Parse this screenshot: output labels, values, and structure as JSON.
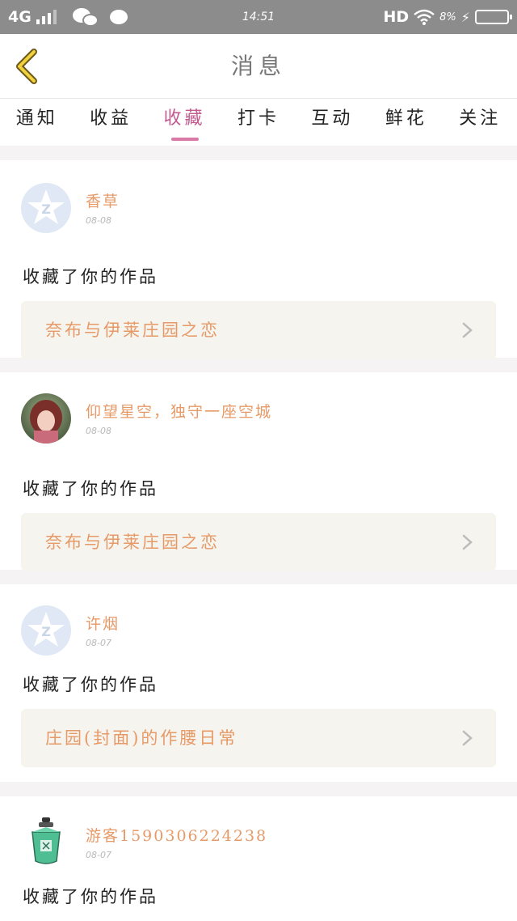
{
  "status_bar": {
    "network": "4G",
    "time": "14:51",
    "hd": "HD",
    "battery": "8%"
  },
  "header": {
    "title": "消息",
    "back_icon": "back-chevron-icon"
  },
  "tabs": [
    {
      "label": "通知",
      "active": false
    },
    {
      "label": "收益",
      "active": false
    },
    {
      "label": "收藏",
      "active": true
    },
    {
      "label": "打卡",
      "active": false
    },
    {
      "label": "互动",
      "active": false
    },
    {
      "label": "鲜花",
      "active": false
    },
    {
      "label": "关注",
      "active": false
    }
  ],
  "notifications": [
    {
      "user": "香草",
      "date": "08-08",
      "action": "收藏了你的作品",
      "work": "奈布与伊莱庄园之恋",
      "avatar": "default-avatar"
    },
    {
      "user": "仰望星空，独守一座空城",
      "date": "08-08",
      "action": "收藏了你的作品",
      "work": "奈布与伊莱庄园之恋",
      "avatar": "photo-avatar"
    },
    {
      "user": "许烟",
      "date": "08-07",
      "action": "收藏了你的作品",
      "work": "庄园(封面)的作腰日常",
      "avatar": "default-avatar"
    },
    {
      "user": "游客15903062242​38",
      "date": "08-07",
      "action": "收藏了你的作品",
      "work": "",
      "avatar": "potion-avatar"
    }
  ],
  "colors": {
    "accent": "#c25a8f",
    "username": "#e59a68",
    "work_bg": "#f6f4ee"
  }
}
